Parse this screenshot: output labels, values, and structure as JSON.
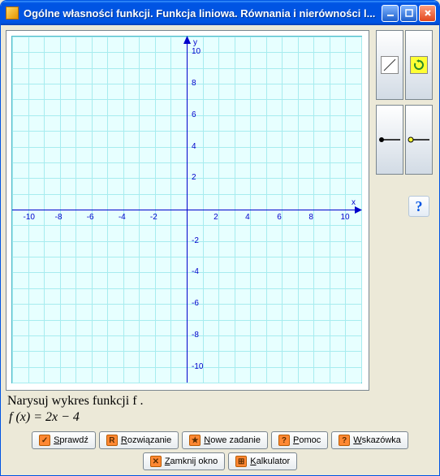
{
  "window": {
    "title": "Ogólne własności funkcji. Funkcja liniowa. Równania i nierówności l..."
  },
  "tools": {
    "line": "line-icon",
    "refresh": "refresh-icon",
    "segment_closed": "segment-closed-icon",
    "segment_open": "segment-open-icon"
  },
  "help_label": "?",
  "task": {
    "prompt": "Narysuj wykres funkcji  f .",
    "formula": "f (x) = 2x − 4"
  },
  "buttons": {
    "check": "Sprawdź",
    "solution": "Rozwiązanie",
    "new_task": "Nowe zadanie",
    "help": "Pomoc",
    "hint": "Wskazówka",
    "close": "Zamknij okno",
    "calc": "Kalkulator"
  },
  "chart_data": {
    "type": "line",
    "title": "",
    "xlabel": "x",
    "ylabel": "y",
    "xlim": [
      -11,
      11
    ],
    "ylim": [
      -11,
      11
    ],
    "x_ticks": [
      -10,
      -8,
      -6,
      -4,
      -2,
      2,
      4,
      6,
      8,
      10
    ],
    "y_ticks": [
      -10,
      -8,
      -6,
      -4,
      -2,
      2,
      4,
      6,
      8,
      10
    ],
    "grid": true,
    "series": []
  }
}
